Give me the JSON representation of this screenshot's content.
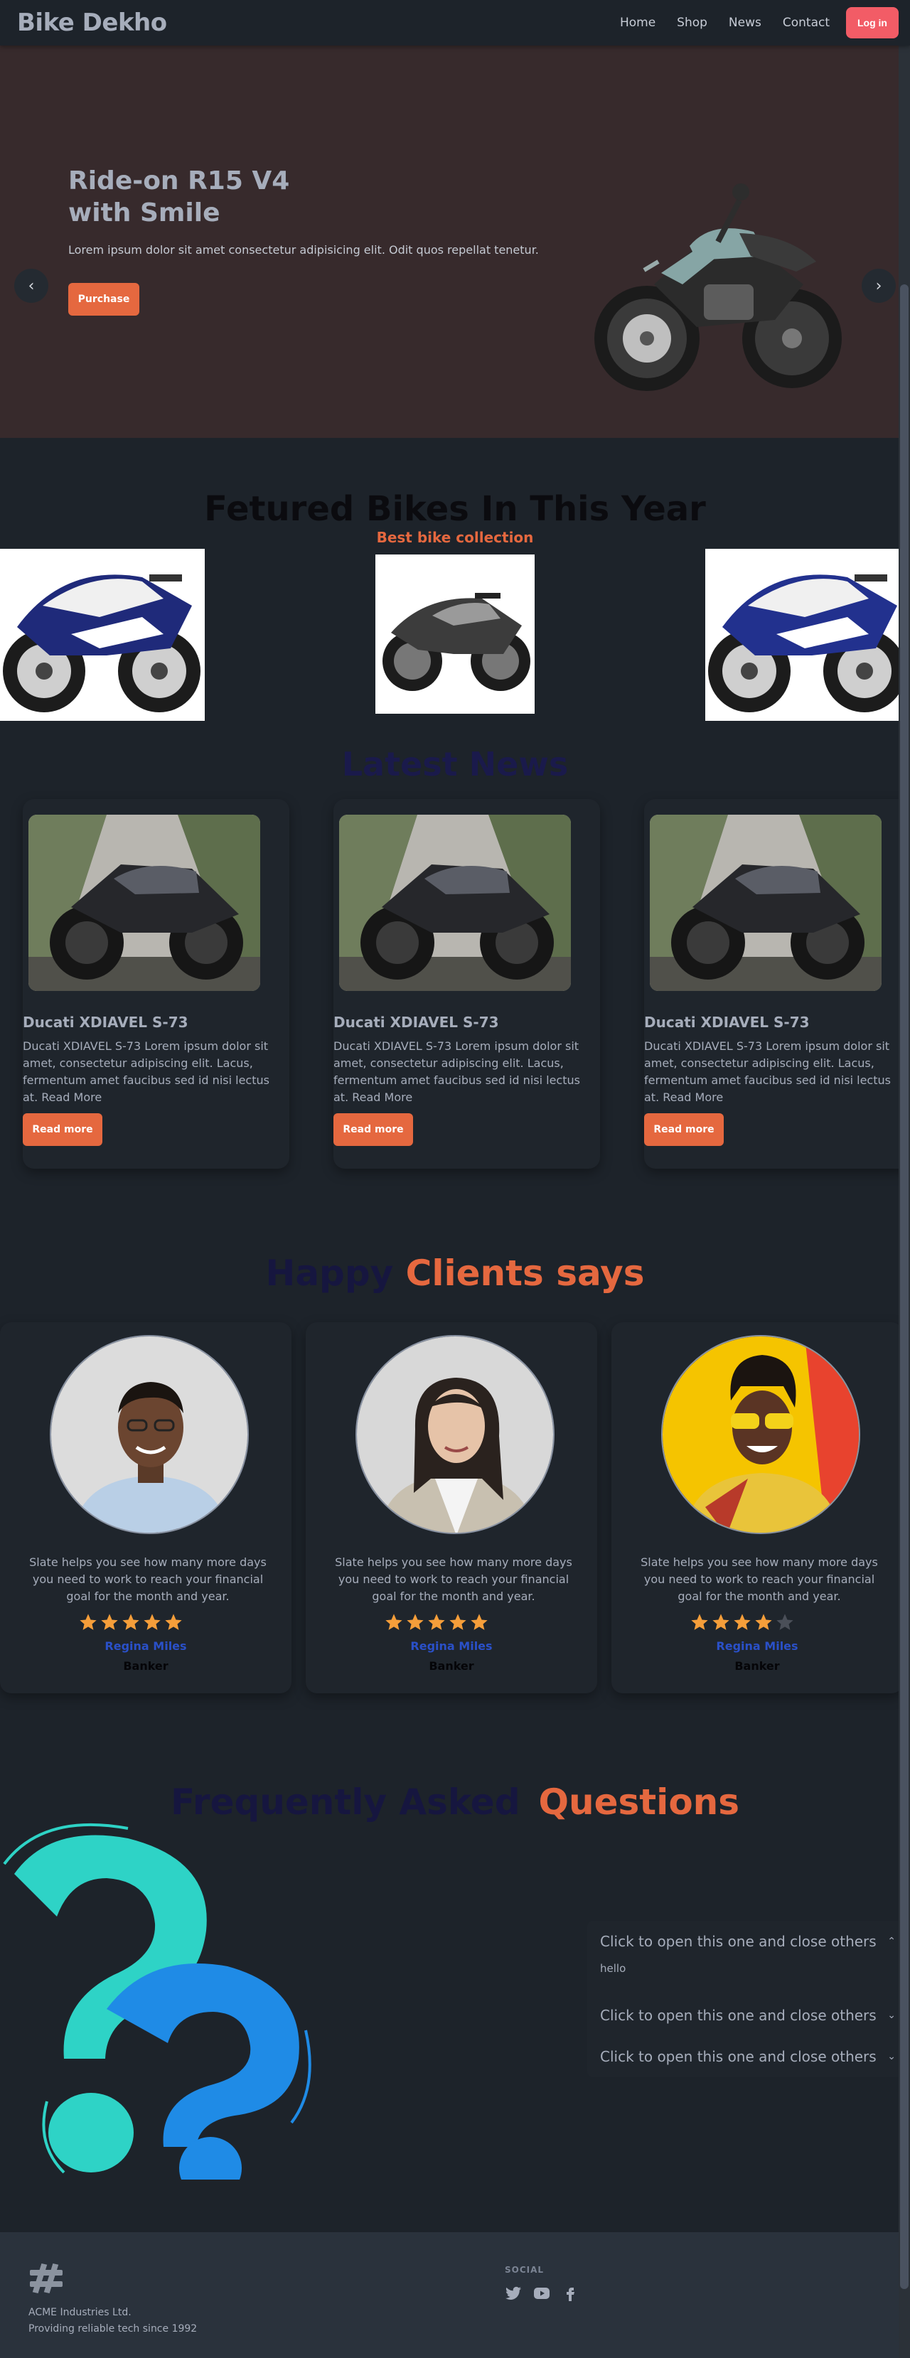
{
  "navbar": {
    "brand": "Bike Dekho",
    "links": [
      "Home",
      "Shop",
      "News",
      "Contact"
    ],
    "login": "Log in"
  },
  "hero": {
    "title": "Ride-on R15 V4 with Smile",
    "text": "Lorem ipsum dolor sit amet consectetur adipisicing elit. Odit quos repellat tenetur.",
    "button": "Purchase",
    "prev": "‹",
    "next": "›"
  },
  "featured": {
    "title": "Fetured Bikes In This Year",
    "subtitle": "Best bike collection"
  },
  "news": {
    "title": "Latest News",
    "cards": [
      {
        "heading": "Ducati XDIAVEL S-73",
        "body": "Ducati XDIAVEL S-73 Lorem ipsum dolor sit amet, consectetur adipiscing elit. Lacus, fermentum amet faucibus sed id nisi lectus at. Read More",
        "button": "Read more"
      },
      {
        "heading": "Ducati XDIAVEL S-73",
        "body": "Ducati XDIAVEL S-73 Lorem ipsum dolor sit amet, consectetur adipiscing elit. Lacus, fermentum amet faucibus sed id nisi lectus at. Read More",
        "button": "Read more"
      },
      {
        "heading": "Ducati XDIAVEL S-73",
        "body": "Ducati XDIAVEL S-73 Lorem ipsum dolor sit amet, consectetur adipiscing elit. Lacus, fermentum amet faucibus sed id nisi lectus at. Read More",
        "button": "Read more"
      }
    ]
  },
  "clients": {
    "title_part1": "Happy",
    "title_part2": "Clients says",
    "cards": [
      {
        "quote": "Slate helps you see how many more days you need to work to reach your financial goal for the month and year.",
        "rating": 5,
        "name": "Regina Miles",
        "role": "Banker"
      },
      {
        "quote": "Slate helps you see how many more days you need to work to reach your financial goal for the month and year.",
        "rating": 5,
        "name": "Regina Miles",
        "role": "Banker"
      },
      {
        "quote": "Slate helps you see how many more days you need to work to reach your financial goal for the month and year.",
        "rating": 4,
        "name": "Regina Miles",
        "role": "Banker"
      }
    ]
  },
  "faq": {
    "title_part1": "Frequently Asked",
    "title_part2": "Questions",
    "items": [
      {
        "question": "Click to open this one and close others",
        "answer": "hello",
        "open": true
      },
      {
        "question": "Click to open this one and close others",
        "answer": "",
        "open": false
      },
      {
        "question": "Click to open this one and close others",
        "answer": "",
        "open": false
      }
    ]
  },
  "footer": {
    "company_name": "ACME Industries Ltd.",
    "company_tagline": "Providing reliable tech since 1992",
    "social_title": "SOCIAL",
    "social_icons": [
      "twitter-icon",
      "youtube-icon",
      "facebook-icon"
    ]
  },
  "colors": {
    "accent": "#e5683f",
    "login": "#f25c66",
    "background": "#1d232a",
    "hero_bg": "#372a2c",
    "star": "#f59e3a"
  }
}
